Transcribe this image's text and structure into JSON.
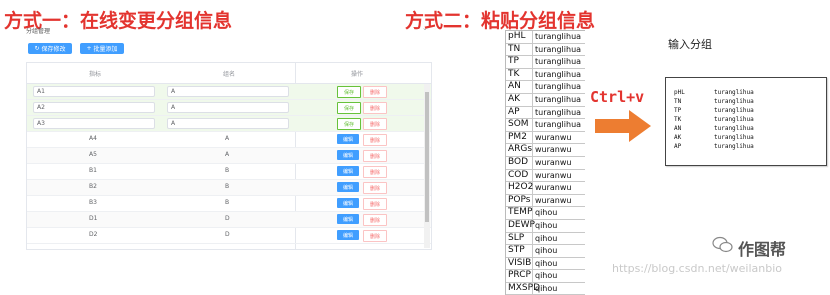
{
  "titles": {
    "method1": "方式一：在线变更分组信息",
    "method2": "方式二：粘贴分组信息",
    "shortcut": "Ctrl+v"
  },
  "left_panel": {
    "section_label": "分组管理",
    "toolbar": {
      "save_label": "保存修改",
      "add_label": "批量添加"
    },
    "columns": [
      "指标",
      "组名",
      "操作"
    ],
    "edit_rows": [
      {
        "key": "A1",
        "group": "A",
        "save": "保存",
        "delete": "删除"
      },
      {
        "key": "A2",
        "group": "A",
        "save": "保存",
        "delete": "删除"
      },
      {
        "key": "A3",
        "group": "A",
        "save": "保存",
        "delete": "删除"
      }
    ],
    "rows": [
      {
        "key": "A4",
        "group": "A",
        "edit": "编辑",
        "delete": "删除"
      },
      {
        "key": "A5",
        "group": "A",
        "edit": "编辑",
        "delete": "删除"
      },
      {
        "key": "B1",
        "group": "B",
        "edit": "编辑",
        "delete": "删除"
      },
      {
        "key": "B2",
        "group": "B",
        "edit": "编辑",
        "delete": "删除"
      },
      {
        "key": "B3",
        "group": "B",
        "edit": "编辑",
        "delete": "删除"
      },
      {
        "key": "D1",
        "group": "D",
        "edit": "编辑",
        "delete": "删除"
      },
      {
        "key": "D2",
        "group": "D",
        "edit": "编辑",
        "delete": "删除"
      },
      {
        "key": "C1",
        "group": "C",
        "edit": "编辑",
        "delete": "删除"
      },
      {
        "key": "C2",
        "group": "C",
        "edit": "编辑",
        "delete": "删除"
      }
    ]
  },
  "spreadsheet": {
    "rows": [
      [
        "pHL",
        "turanglihua"
      ],
      [
        "TN",
        "turanglihua"
      ],
      [
        "TP",
        "turanglihua"
      ],
      [
        "TK",
        "turanglihua"
      ],
      [
        "AN",
        "turanglihua"
      ],
      [
        "AK",
        "turanglihua"
      ],
      [
        "AP",
        "turanglihua"
      ],
      [
        "SOM",
        "turanglihua"
      ],
      [
        "PM2",
        "wuranwu"
      ],
      [
        "ARGs",
        "wuranwu"
      ],
      [
        "BOD",
        "wuranwu"
      ],
      [
        "COD",
        "wuranwu"
      ],
      [
        "H2O2",
        "wuranwu"
      ],
      [
        "POPs",
        "wuranwu"
      ],
      [
        "TEMP",
        "qihou"
      ],
      [
        "DEWP",
        "qihou"
      ],
      [
        "SLP",
        "qihou"
      ],
      [
        "STP",
        "qihou"
      ],
      [
        "VISIB",
        "qihou"
      ],
      [
        "PRCP",
        "qihou"
      ],
      [
        "MXSPD",
        "qihou"
      ]
    ]
  },
  "paste_panel": {
    "label": "输入分组",
    "lines": [
      [
        "pHL",
        "turanglihua"
      ],
      [
        "TN",
        "turanglihua"
      ],
      [
        "TP",
        "turanglihua"
      ],
      [
        "TK",
        "turanglihua"
      ],
      [
        "AN",
        "turanglihua"
      ],
      [
        "AK",
        "turanglihua"
      ],
      [
        "AP",
        "turanglihua"
      ]
    ]
  },
  "watermark": {
    "brand": "作图帮",
    "url": "https://blog.csdn.net/weilanbio"
  },
  "colors": {
    "title_red": "#e3342f",
    "arrow_orange": "#ed7d31",
    "primary_blue": "#409eff",
    "success_green": "#67c23a",
    "danger_red": "#f56c6c"
  }
}
